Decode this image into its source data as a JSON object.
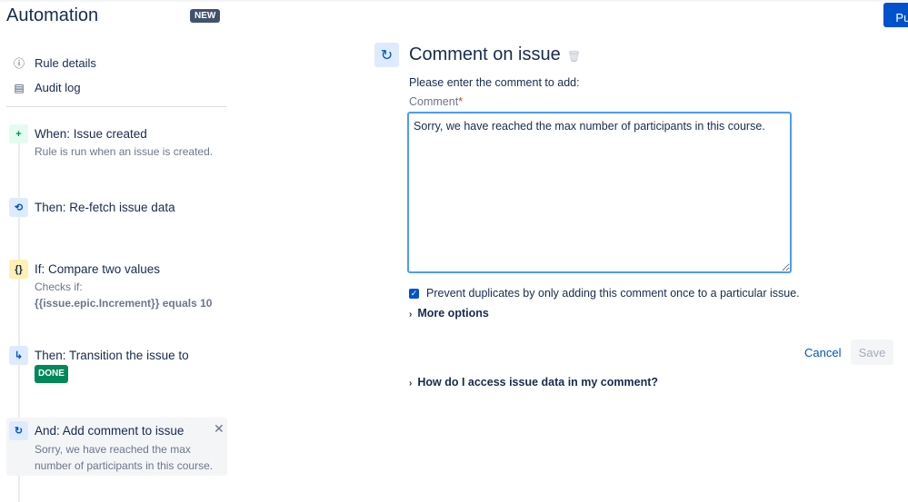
{
  "app": {
    "title": "Automation",
    "badge": "NEW",
    "publish_label": "Pub"
  },
  "nav": [
    {
      "label": "Rule details",
      "icon": "info-icon"
    },
    {
      "label": "Audit log",
      "icon": "document-icon"
    }
  ],
  "steps": [
    {
      "heading": "When: Issue created",
      "desc": "Rule is run when an issue is created.",
      "color": "#e3fcef"
    },
    {
      "heading": "Then: Re-fetch issue data",
      "color": "#deebff"
    },
    {
      "heading": "If: Compare two values",
      "desc": "Checks if:",
      "desc2": "{{issue.epic.Increment}} equals 10",
      "color": "#fff0b3"
    },
    {
      "heading": "Then: Transition the issue to",
      "badge": "DONE",
      "color": "#deebff"
    },
    {
      "heading": "And: Add comment to issue",
      "desc": "Sorry, we have reached the max",
      "desc2": "number of participants in this course.",
      "color": "#deebff"
    }
  ],
  "panel": {
    "title": "Comment on issue",
    "prompt": "Please enter the comment to add:",
    "field_label": "Comment",
    "required": "*",
    "comment": "Sorry, we have reached the max number of participants in this course.",
    "prevent_duplicates": "Prevent duplicates by only adding this comment once to a particular issue.",
    "more_options": "More options",
    "cancel": "Cancel",
    "save": "Save",
    "help": "How do I access issue data in my comment?"
  }
}
